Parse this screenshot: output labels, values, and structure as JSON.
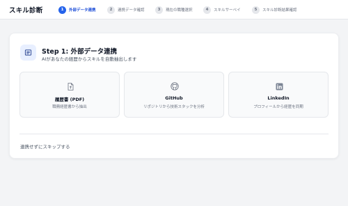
{
  "app": {
    "title": "スキル診断"
  },
  "steps": [
    {
      "num": "1",
      "label": "外部データ連携",
      "active": true
    },
    {
      "num": "2",
      "label": "連携データ確認",
      "active": false
    },
    {
      "num": "3",
      "label": "現在の職種選択",
      "active": false
    },
    {
      "num": "4",
      "label": "スキルサーベイ",
      "active": false
    },
    {
      "num": "5",
      "label": "スキル診断結果確認",
      "active": false
    }
  ],
  "main": {
    "title": "Step 1: 外部データ連携",
    "description": "AIがあなたの経歴からスキルを自動抽出します",
    "sources": [
      {
        "name": "履歴書 (PDF)",
        "desc": "職務経歴書から抽出",
        "icon": "file-upload-icon"
      },
      {
        "name": "GitHub",
        "desc": "リポジトリから技術スタックを分析",
        "icon": "github-icon"
      },
      {
        "name": "LinkedIn",
        "desc": "プロフィールから経歴を同期",
        "icon": "linkedin-icon"
      }
    ],
    "skip_label": "連携せずにスキップする"
  },
  "colors": {
    "accent": "#2563eb",
    "icon_bg": "#e8efff"
  }
}
